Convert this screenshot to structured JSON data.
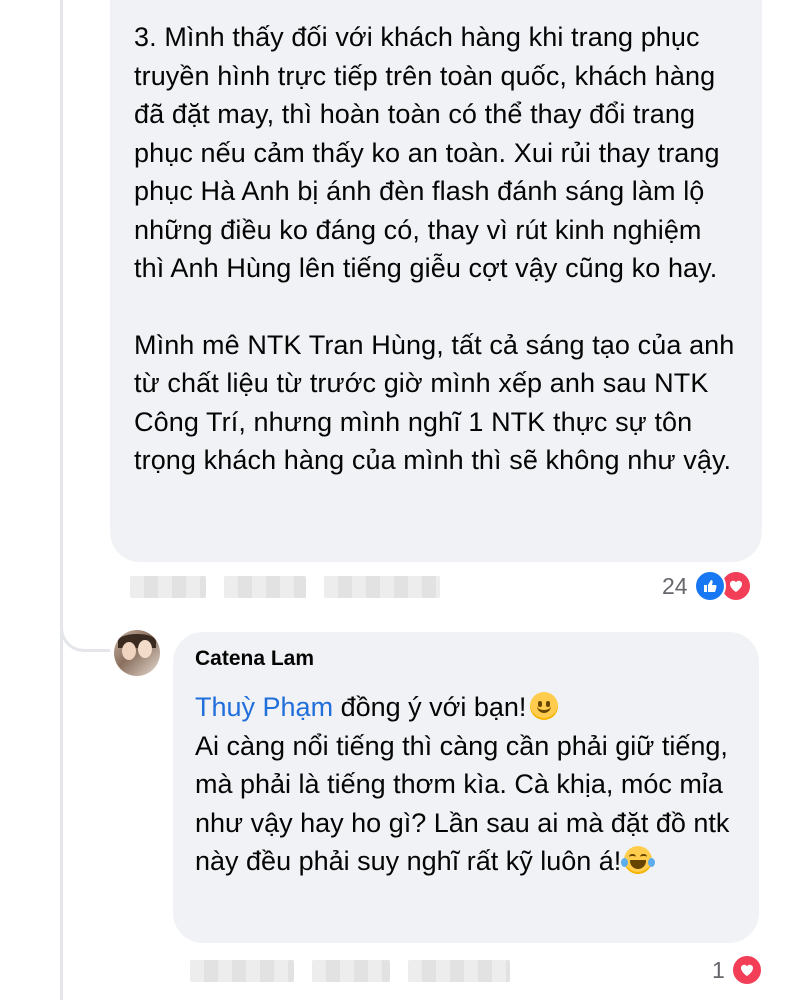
{
  "comment": {
    "paragraphs": [
      "3. Mình thấy đối với khách hàng khi trang phục truyền hình trực tiếp trên toàn quốc, khách hàng đã đặt may, thì hoàn toàn có thể thay đổi trang phục nếu cảm thấy ko an toàn. Xui rủi thay trang phục Hà Anh bị ánh đèn flash đánh sáng làm lộ những điều ko đáng có, thay vì rút kinh nghiệm thì Anh Hùng lên tiếng giễu cợt vậy cũng ko hay.",
      "Mình mê NTK Tran Hùng, tất cả sáng tạo của anh từ chất liệu từ trước giờ mình xếp anh sau NTK Công Trí, nhưng mình nghĩ 1 NTK thực sự tôn trọng khách hàng của mình thì sẽ không như vậy."
    ],
    "reaction_count": "24",
    "reaction_icons": [
      "like-icon",
      "love-icon"
    ]
  },
  "reply": {
    "author": "Catena Lam",
    "mention": "Thuỳ Phạm",
    "line1_rest": " đồng ý với bạn!",
    "body": "Ai càng nổi tiếng thì càng cần phải giữ tiếng, mà phải là tiếng thơm kìa. Cà khịa, móc mỉa như vậy hay ho gì? Lần sau ai mà đặt đồ ntk này đều phải suy nghĩ rất kỹ luôn á!",
    "emoji_1": "smiling-face-emoji",
    "emoji_2": "tears-of-joy-emoji",
    "reaction_count": "1",
    "reaction_icons": [
      "love-icon"
    ]
  },
  "colors": {
    "bubble": "#f0f2f5",
    "mention": "#216fdb",
    "like": "#1877f2",
    "love": "#f33e58",
    "meta_text": "#65676b"
  }
}
